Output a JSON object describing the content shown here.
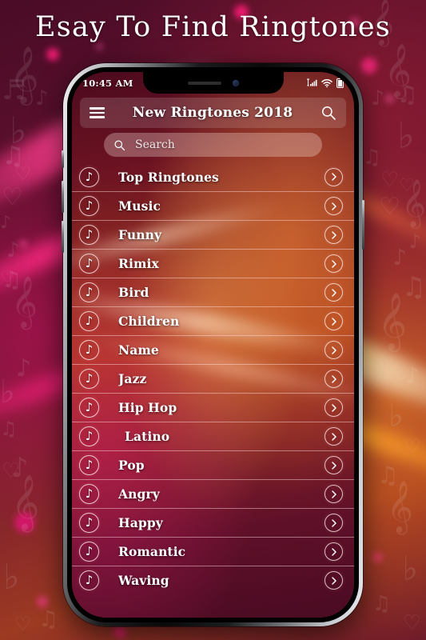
{
  "poster": {
    "title": "Esay To Find Ringtones",
    "background_colors": {
      "maroon": "#5b0f2c",
      "orange": "#9c3a22",
      "pink_glow": "#ff2882",
      "amber_glow": "#ffa028"
    }
  },
  "phone": {
    "status_bar": {
      "time": "10:45 AM",
      "icons": [
        "signal-icon",
        "wifi-icon",
        "battery-icon"
      ]
    },
    "app_bar": {
      "menu_icon": "hamburger-menu-icon",
      "title": "New Ringtones 2018",
      "search_icon": "search-icon"
    },
    "search": {
      "icon": "search-icon",
      "placeholder": "Search",
      "value": ""
    },
    "list": {
      "row_icon": "music-note-icon",
      "row_action_icon": "chevron-right-icon",
      "items": [
        {
          "label": "Top Ringtones",
          "indent": false
        },
        {
          "label": "Music",
          "indent": false
        },
        {
          "label": "Funny",
          "indent": false
        },
        {
          "label": "Rimix",
          "indent": false
        },
        {
          "label": "Bird",
          "indent": false
        },
        {
          "label": "Children",
          "indent": false
        },
        {
          "label": "Name",
          "indent": false
        },
        {
          "label": "Jazz",
          "indent": false
        },
        {
          "label": "Hip Hop",
          "indent": false
        },
        {
          "label": "Latino",
          "indent": true
        },
        {
          "label": "Pop",
          "indent": false
        },
        {
          "label": "Angry",
          "indent": false
        },
        {
          "label": "Happy",
          "indent": false
        },
        {
          "label": "Romantic",
          "indent": false
        },
        {
          "label": "Waving",
          "indent": false
        }
      ]
    }
  }
}
